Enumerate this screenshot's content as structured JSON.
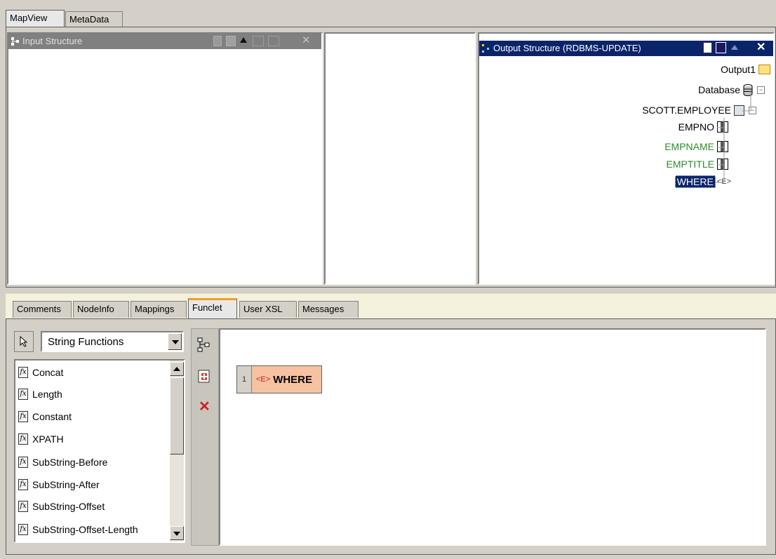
{
  "top_tabs": [
    {
      "label": "MapView",
      "active": true
    },
    {
      "label": "MetaData",
      "active": false
    }
  ],
  "input_panel": {
    "title": "Input Structure",
    "icons": [
      "new-doc-icon",
      "save-icon",
      "up-arrow-icon",
      "expand-tree-icon",
      "collapse-tree-icon",
      "close-icon"
    ]
  },
  "output_panel": {
    "title": "Output Structure (RDBMS-UPDATE)",
    "icons": [
      "new-doc-icon",
      "save-icon",
      "up-arrow-icon",
      "close-icon"
    ],
    "tree": [
      {
        "label": "Output1",
        "icon": "folder-icon",
        "color": "#000000"
      },
      {
        "label": "Database",
        "icon": "database-icon",
        "color": "#000000"
      },
      {
        "label": "SCOTT.EMPLOYEE",
        "icon": "table-icon",
        "color": "#000000"
      },
      {
        "label": "EMPNO",
        "icon": "column-icon",
        "color": "#000000"
      },
      {
        "label": "EMPNAME",
        "icon": "column-icon",
        "color": "#2e8b2e"
      },
      {
        "label": "EMPTITLE",
        "icon": "column-icon",
        "color": "#2e8b2e"
      },
      {
        "label": "WHERE",
        "icon": "element-icon",
        "color": "#ffffff",
        "selected": true,
        "element_tag": "<E>"
      }
    ]
  },
  "bottom_tabs": [
    {
      "label": "Comments",
      "active": false
    },
    {
      "label": "NodeInfo",
      "active": false
    },
    {
      "label": "Mappings",
      "active": false
    },
    {
      "label": "Funclet",
      "active": true
    },
    {
      "label": "User XSL",
      "active": false
    },
    {
      "label": "Messages",
      "active": false
    }
  ],
  "funclet": {
    "category_select": "String Functions",
    "functions": [
      "Concat",
      "Length",
      "Constant",
      "XPATH",
      "SubString-Before",
      "SubString-After",
      "SubString-Offset",
      "SubString-Offset-Length"
    ],
    "side_tools": [
      "tree-icon",
      "add-icon",
      "delete-icon"
    ],
    "canvas_node": {
      "index": "1",
      "tag": "<E>",
      "label": "WHERE"
    }
  },
  "colors": {
    "input_title_bg": "#808080",
    "output_title_bg": "#0a246a",
    "selection_bg": "#0a246a",
    "green_text": "#2e8b2e",
    "node_fill": "#f7c2a2"
  }
}
